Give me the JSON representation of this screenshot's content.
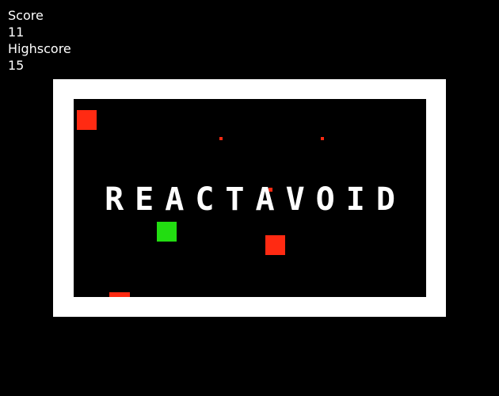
{
  "hud": {
    "score_label": "Score",
    "score_value": "11",
    "highscore_label": "Highscore",
    "highscore_value": "15"
  },
  "game": {
    "title": "REACTAVOID",
    "colors": {
      "background": "#000000",
      "frame": "#ffffff",
      "enemy": "#ff2a12",
      "player": "#22dd11",
      "text": "#ffffff"
    }
  }
}
